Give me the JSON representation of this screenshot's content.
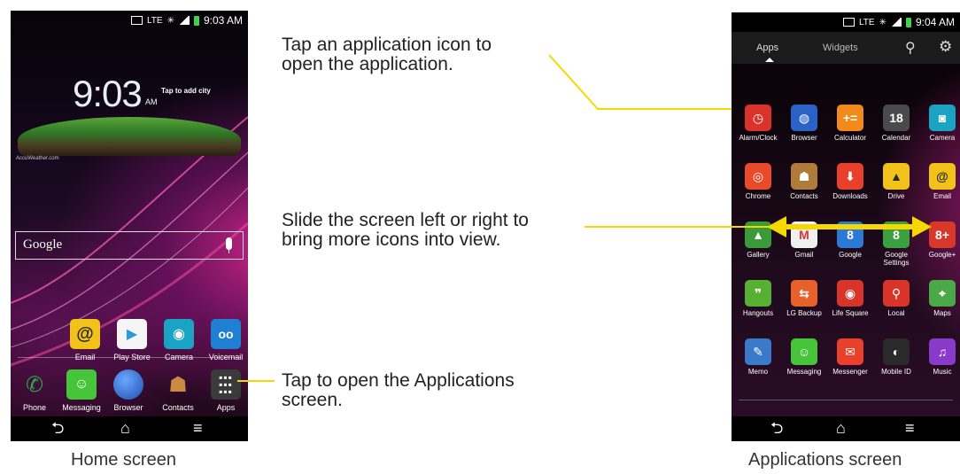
{
  "home": {
    "status_time": "9:03 AM",
    "status_lte": "LTE",
    "clock": "9:03",
    "ampm": "AM",
    "city_prompt": "Tap to add city",
    "accuweather": "AccuWeather.com",
    "google_label": "Google",
    "icons": [
      {
        "label": "Email",
        "icon": "email-at-icon",
        "color": "#f2c21a"
      },
      {
        "label": "Play Store",
        "icon": "play-store-icon",
        "color": "#f5f5f5"
      },
      {
        "label": "Camera",
        "icon": "camera-icon",
        "color": "#1aa3c2"
      },
      {
        "label": "Voicemail",
        "icon": "voicemail-icon",
        "color": "#1f7fd2"
      }
    ],
    "dock": [
      {
        "label": "Phone",
        "icon": "phone-icon",
        "color": "#2aa84a"
      },
      {
        "label": "Messaging",
        "icon": "messaging-icon",
        "color": "#46c43a"
      },
      {
        "label": "Browser",
        "icon": "globe-icon",
        "color": "#2a62c8"
      },
      {
        "label": "Contacts",
        "icon": "contacts-icon",
        "color": "#b07a3a"
      },
      {
        "label": "Apps",
        "icon": "apps-grid-icon",
        "color": "#444444"
      }
    ],
    "caption": "Home screen"
  },
  "apps": {
    "status_time": "9:04 AM",
    "status_lte": "LTE",
    "tabs": [
      "Apps",
      "Widgets"
    ],
    "grid": [
      [
        "Alarm/Clock",
        "Browser",
        "Calculator",
        "Calendar",
        "Camera"
      ],
      [
        "Chrome",
        "Contacts",
        "Downloads",
        "Drive",
        "Email"
      ],
      [
        "Gallery",
        "Gmail",
        "Google",
        "Google Settings",
        "Google+"
      ],
      [
        "Hangouts",
        "LG Backup",
        "Life Square",
        "Local",
        "Maps"
      ],
      [
        "Memo",
        "Messaging",
        "Messenger",
        "Mobile ID",
        "Music"
      ]
    ],
    "grid_colors": [
      [
        "#d9332b",
        "#2a62c8",
        "#f08a1a",
        "#4a4a4a",
        "#1aa3c2"
      ],
      [
        "#e84a2a",
        "#b07a3a",
        "#e8402a",
        "#f2c21a",
        "#f2c21a"
      ],
      [
        "#3a9a3a",
        "#f0f0f0",
        "#2a78d8",
        "#3aa040",
        "#d8382a"
      ],
      [
        "#58b032",
        "#e8602a",
        "#d8342a",
        "#d8342a",
        "#4aa848"
      ],
      [
        "#3a7ac8",
        "#46c43a",
        "#e8402a",
        "#2a2a2a",
        "#8a3ac8"
      ]
    ],
    "calendar_day": "18",
    "caption": "Applications screen"
  },
  "callouts": {
    "tap_icon": [
      "Tap an application icon to",
      "open the application."
    ],
    "slide": [
      "Slide the screen left or right to",
      "bring more icons into view."
    ],
    "tap_apps": [
      "Tap to open the Applications",
      "screen."
    ]
  },
  "colors": {
    "callout_line": "#f5d800"
  }
}
